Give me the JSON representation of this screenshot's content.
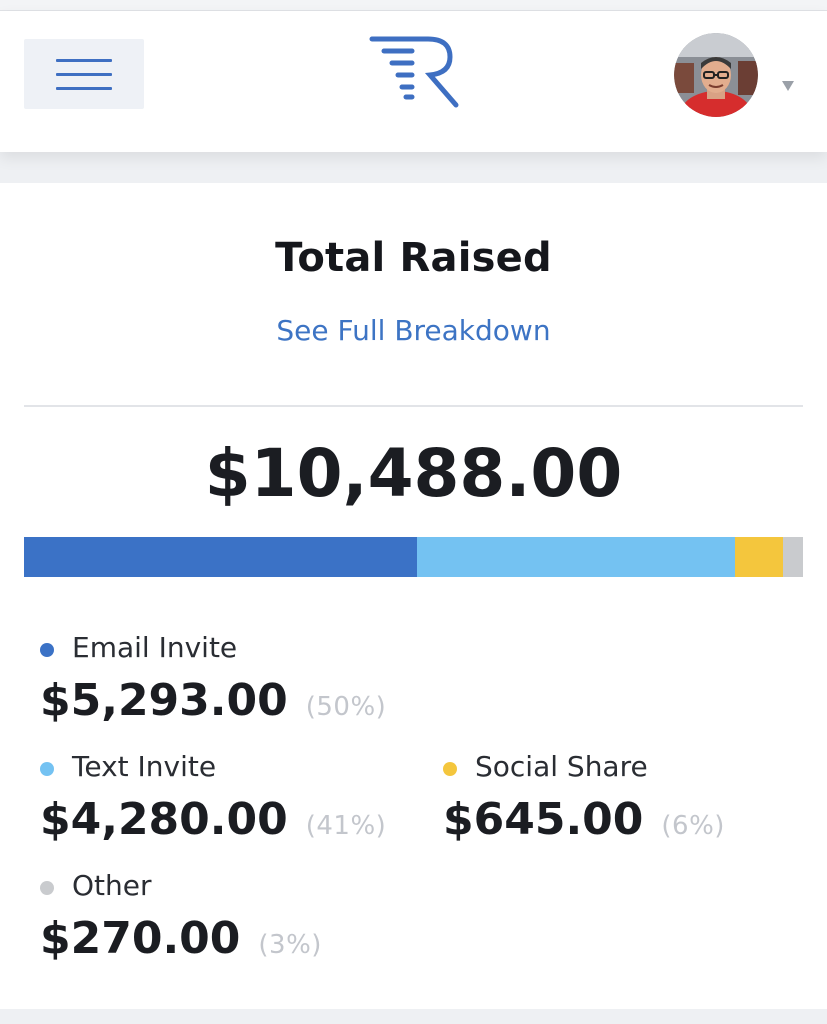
{
  "header": {
    "menu_icon": "hamburger-menu-icon",
    "logo_icon": "r-logo-icon",
    "avatar_icon": "user-avatar-photo",
    "dropdown_icon": "caret-down-icon",
    "brand_color": "#3e6fc2"
  },
  "summary": {
    "title": "Total Raised",
    "breakdown_link": "See Full Breakdown",
    "total": "$10,488.00"
  },
  "breakdown": [
    {
      "label": "Email Invite",
      "amount": "$5,293.00",
      "percent": "(50%)",
      "share": 50.47,
      "color": "#3b72c6"
    },
    {
      "label": "Text Invite",
      "amount": "$4,280.00",
      "percent": "(41%)",
      "share": 40.81,
      "color": "#74c2f2"
    },
    {
      "label": "Social Share",
      "amount": "$645.00",
      "percent": "(6%)",
      "share": 6.15,
      "color": "#f4c63d"
    },
    {
      "label": "Other",
      "amount": "$270.00",
      "percent": "(3%)",
      "share": 2.57,
      "color": "#c9cbce"
    }
  ]
}
